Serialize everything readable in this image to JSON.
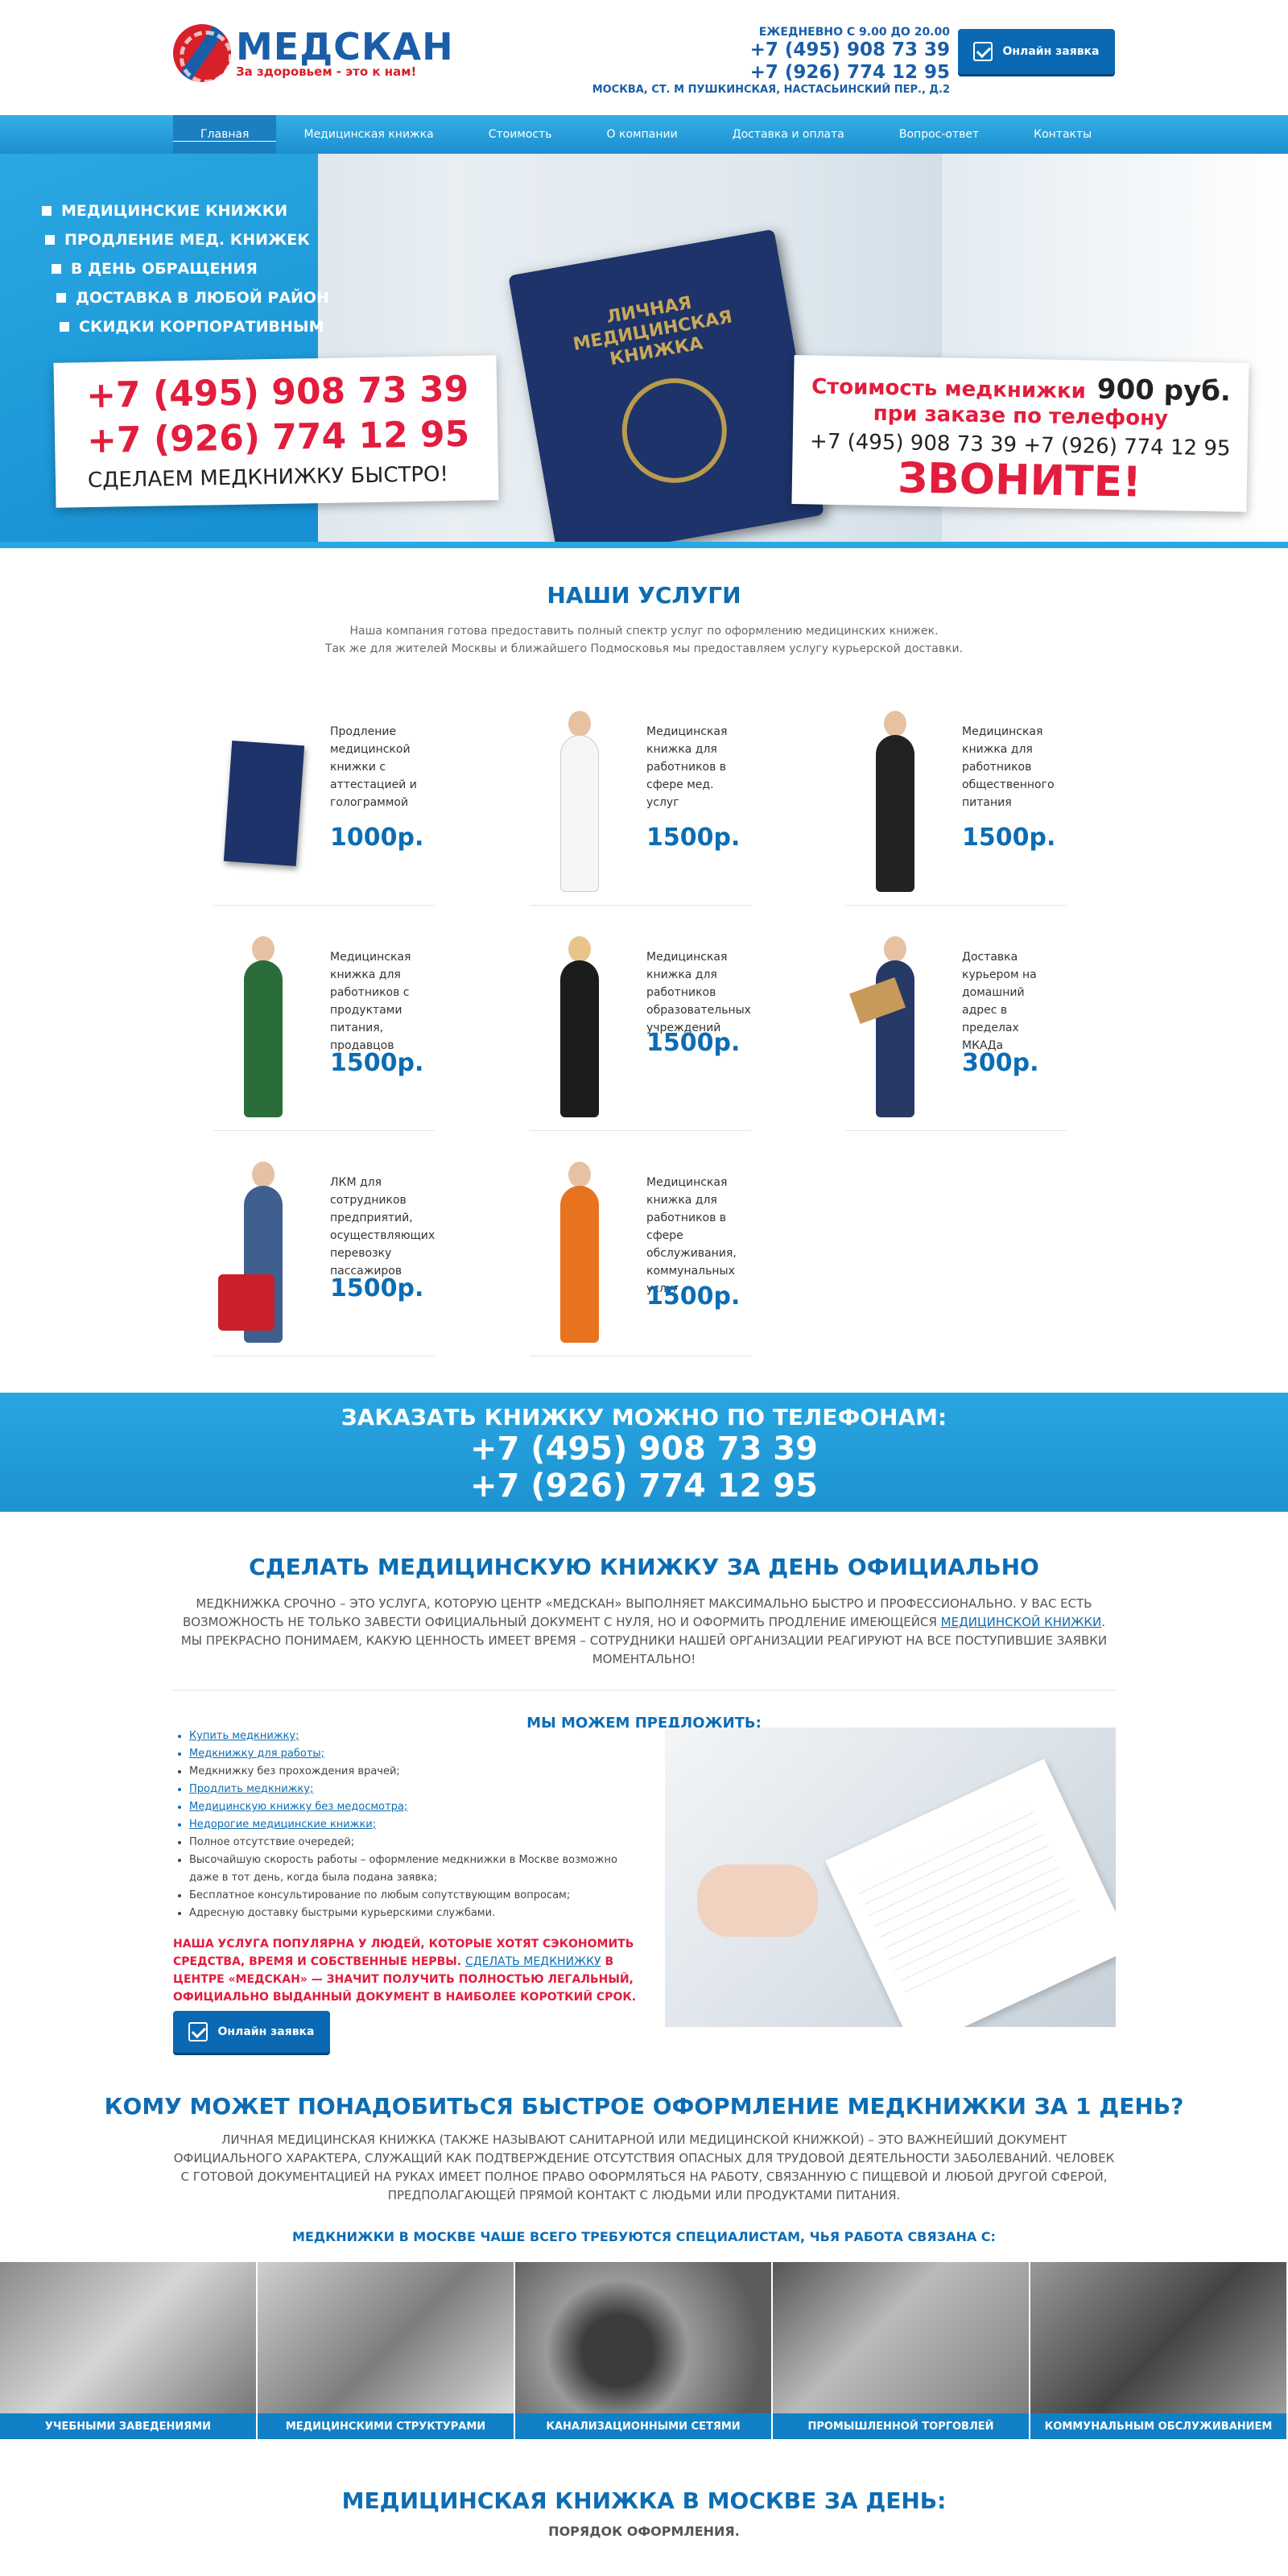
{
  "brand": {
    "name": "МЕДСКАН",
    "slogan": "За здоровьем - это к нам!"
  },
  "header": {
    "hours": "ЕЖЕДНЕВНО С 9.00 ДО 20.00",
    "phone1": "+7 (495) 908 73 39",
    "phone2": "+7 (926) 774 12 95",
    "address": "МОСКВА, СТ. М ПУШКИНСКАЯ, НАСТАСЬИНСКИЙ ПЕР., Д.2",
    "cta": "Онлайн заявка"
  },
  "nav": [
    "Главная",
    "Медицинская книжка",
    "Стоимость",
    "О компании",
    "Доставка и оплата",
    "Вопрос-ответ",
    "Контакты"
  ],
  "hero": {
    "list": [
      "МЕДИЦИНСКИЕ КНИЖКИ",
      "ПРОДЛЕНИЕ МЕД. КНИЖЕК",
      "В ДЕНЬ ОБРАЩЕНИЯ",
      "ДОСТАВКА В ЛЮБОЙ РАЙОН",
      "СКИДКИ КОРПОРАТИВНЫМ"
    ],
    "phone1": "+7 (495) 908 73 39",
    "phone2": "+7 (926) 774 12 95",
    "fast": "СДЕЛАЕМ МЕДКНИЖКУ БЫСТРО!",
    "passport": "ЛИЧНАЯ МЕДИЦИНСКАЯ КНИЖКА",
    "price_label": "Стоимость медкнижки",
    "price_value": "900 руб.",
    "price_note": "при заказе по телефону",
    "phones_line": "+7 (495) 908 73 39 +7 (926) 774 12 95",
    "call": "ЗВОНИТЕ!"
  },
  "services": {
    "title": "НАШИ УСЛУГИ",
    "intro1": "Наша компания готова предоставить полный спектр услуг по оформлению медицинских книжек.",
    "intro2": "Так же для жителей Москвы и ближайшего Подмосковья мы предоставляем услугу курьерской доставки.",
    "items": [
      {
        "text": "Продление медицинской книжки с аттестацией и голограммой",
        "price": "1000р."
      },
      {
        "text": "Медицинская книжка для работников в сфере мед. услуг",
        "price": "1500р."
      },
      {
        "text": "Медицинская книжка для работников общественного питания",
        "price": "1500р."
      },
      {
        "text": "Медицинская книжка для работников с продуктами питания, продавцов",
        "price": "1500р."
      },
      {
        "text": "Медицинская книжка для работников образовательных учреждений",
        "price": "1500р."
      },
      {
        "text": "Доставка курьером на домашний адрес в пределах МКАДа",
        "price": "300р."
      },
      {
        "text": "ЛКМ для сотрудников предприятий, осуществляющих перевозку пассажиров",
        "price": "1500р."
      },
      {
        "text": "Медицинская книжка для работников в сфере обслуживания, коммунальных услуг",
        "price": "1500р."
      }
    ]
  },
  "order_band": {
    "title": "ЗАКАЗАТЬ КНИЖКУ МОЖНО ПО ТЕЛЕФОНАМ:",
    "phone1": "+7 (495) 908 73 39",
    "phone2": "+7 (926) 774 12 95"
  },
  "oneday": {
    "title": "СДЕЛАТЬ МЕДИЦИНСКУЮ КНИЖКУ ЗА ДЕНЬ ОФИЦИАЛЬНО",
    "para_before": "МЕДКНИЖКА СРОЧНО – ЭТО УСЛУГА, КОТОРУЮ ЦЕНТР «МЕДСКАН» ВЫПОЛНЯЕТ МАКСИМАЛЬНО БЫСТРО И ПРОФЕССИОНАЛЬНО. У ВАС ЕСТЬ ВОЗМОЖНОСТЬ НЕ ТОЛЬКО ЗАВЕСТИ ОФИЦИАЛЬНЫЙ ДОКУМЕНТ С НУЛЯ, НО И ОФОРМИТЬ ПРОДЛЕНИЕ ИМЕЮЩЕЙСЯ ",
    "para_link": "МЕДИЦИНСКОЙ КНИЖКИ",
    "para_after": ". МЫ ПРЕКРАСНО ПОНИМАЕМ, КАКУЮ ЦЕННОСТЬ ИМЕЕТ ВРЕМЯ – СОТРУДНИКИ НАШЕЙ ОРГАНИЗАЦИИ РЕАГИРУЮТ НА ВСЕ ПОСТУПИВШИЕ ЗАЯВКИ МОМЕНТАЛЬНО!",
    "offer_title": "МЫ МОЖЕМ ПРЕДЛОЖИТЬ:",
    "offer": [
      {
        "text": "Купить медкнижку;",
        "link": true
      },
      {
        "text": "Медкнижку для работы;",
        "link": true
      },
      {
        "text": "Медкнижку без прохождения врачей;",
        "link": false
      },
      {
        "text": "Продлить медкнижку;",
        "link": true
      },
      {
        "text": "Медицинскую книжку без медосмотра;",
        "link": true
      },
      {
        "text": "Недорогие медицинские книжки;",
        "link": true
      },
      {
        "text": "Полное отсутствие очередей;",
        "link": false
      },
      {
        "text": "Высочайшую скорость работы – оформление медкнижки в Москве возможно даже в тот день, когда была подана заявка;",
        "link": false
      },
      {
        "text": "Бесплатное консультирование по любым сопутствующим вопросам;",
        "link": false
      },
      {
        "text": "Адресную доставку быстрыми курьерскими службами.",
        "link": false
      }
    ],
    "note_before": "НАША УСЛУГА ПОПУЛЯРНА У ЛЮДЕЙ, КОТОРЫЕ ХОТЯТ СЭКОНОМИТЬ СРЕДСТВА, ВРЕМЯ И СОБСТВЕННЫЕ НЕРВЫ. ",
    "note_link": "СДЕЛАТЬ МЕДКНИЖКУ",
    "note_after": " В ЦЕНТРЕ «МЕДСКАН» — ЗНАЧИТ ПОЛУЧИТЬ ПОЛНОСТЬЮ ЛЕГАЛЬНЫЙ, ОФИЦИАЛЬНО ВЫДАННЫЙ ДОКУМЕНТ В НАИБОЛЕЕ КОРОТКИЙ СРОК.",
    "cta": "Онлайн заявка"
  },
  "who": {
    "title": "КОМУ МОЖЕТ ПОНАДОБИТЬСЯ БЫСТРОЕ ОФОРМЛЕНИЕ МЕДКНИЖКИ ЗА 1 ДЕНЬ?",
    "para": "ЛИЧНАЯ МЕДИЦИНСКАЯ КНИЖКА (ТАКЖЕ НАЗЫВАЮТ САНИТАРНОЙ ИЛИ МЕДИЦИНСКОЙ КНИЖКОЙ) – ЭТО ВАЖНЕЙШИЙ ДОКУМЕНТ ОФИЦИАЛЬНОГО ХАРАКТЕРА, СЛУЖАЩИЙ КАК ПОДТВЕРЖДЕНИЕ ОТСУТСТВИЯ ОПАСНЫХ ДЛЯ ТРУДОВОЙ ДЕЯТЕЛЬНОСТИ ЗАБОЛЕВАНИЙ. ЧЕЛОВЕК С ГОТОВОЙ ДОКУМЕНТАЦИЕЙ НА РУКАХ ИМЕЕТ ПОЛНОЕ ПРАВО ОФОРМЛЯТЬСЯ НА РАБОТУ, СВЯЗАННУЮ С ПИЩЕВОЙ И ЛЮБОЙ ДРУГОЙ СФЕРОЙ, ПРЕДПОЛАГАЮЩЕЙ ПРЯМОЙ КОНТАКТ С ЛЮДЬМИ ИЛИ ПРОДУКТАМИ ПИТАНИЯ.",
    "sub": "МЕДКНИЖКИ В МОСКВЕ ЧАШЕ ВСЕГО ТРЕБУЮТСЯ СПЕЦИАЛИСТАМ, ЧЬЯ РАБОТА СВЯЗАНА С:",
    "strip": [
      "УЧЕБНЫМИ ЗАВЕДЕНИЯМИ",
      "МЕДИЦИНСКИМИ СТРУКТУРАМИ",
      "КАНАЛИЗАЦИОННЫМИ СЕТЯМИ",
      "ПРОМЫШЛЕННОЙ ТОРГОВЛЕЙ",
      "КОММУНАЛЬНЫМ ОБСЛУЖИВАНИЕМ"
    ]
  },
  "bottom": {
    "title": "МЕДИЦИНСКАЯ КНИЖКА В МОСКВЕ ЗА ДЕНЬ:",
    "sub": "ПОРЯДОК ОФОРМЛЕНИЯ."
  }
}
